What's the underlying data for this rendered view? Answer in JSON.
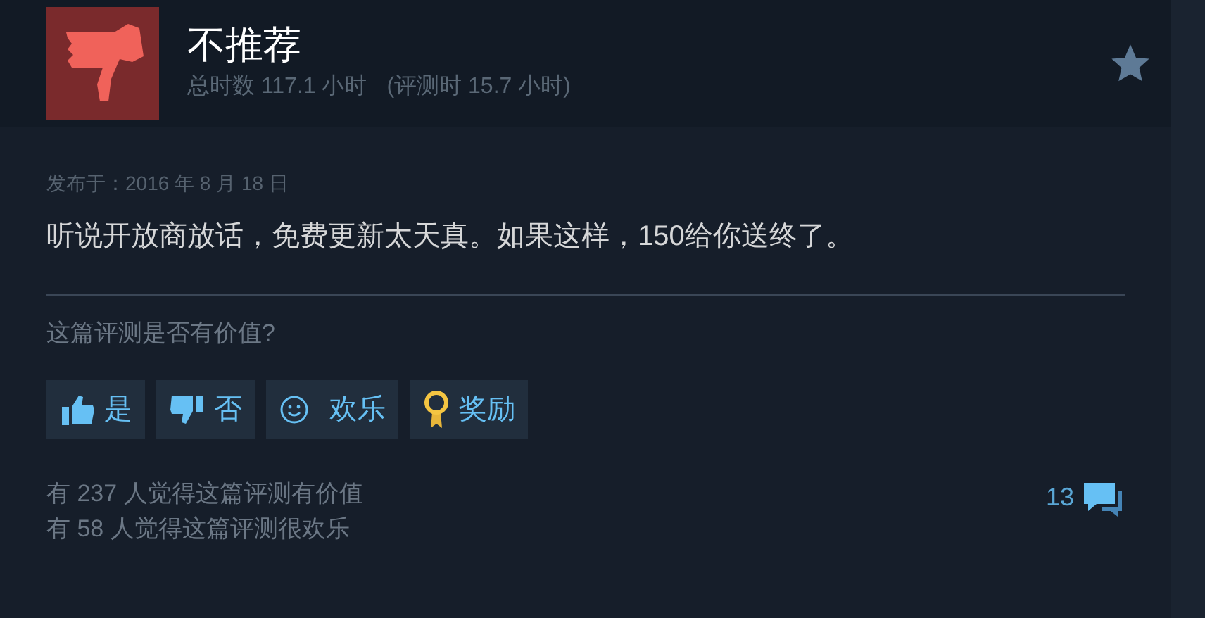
{
  "header": {
    "verdict": "不推荐",
    "hours": "总时数 117.1 小时",
    "review_hours": "(评测时 15.7 小时)"
  },
  "posted": "发布于：2016 年 8 月 18 日",
  "review_text": "听说开放商放话，免费更新太天真。如果这样，150给你送终了。",
  "helpful_prompt": "这篇评测是否有价值?",
  "buttons": [
    {
      "kind": "yes",
      "label": "是"
    },
    {
      "kind": "no",
      "label": "否"
    },
    {
      "kind": "funny",
      "label": "欢乐"
    },
    {
      "kind": "award",
      "label": "奖励"
    }
  ],
  "stats": [
    "有 237 人觉得这篇评测有价值",
    "有 58 人觉得这篇评测很欢乐"
  ],
  "comments": "13"
}
